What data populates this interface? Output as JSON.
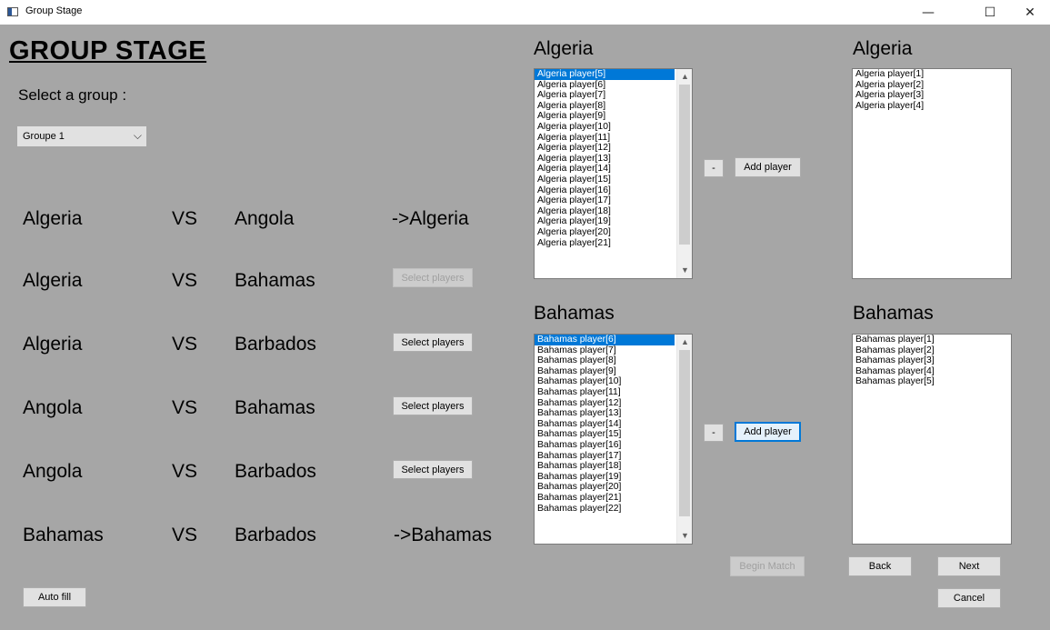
{
  "window": {
    "title": "Group Stage",
    "minimize_glyph": "—",
    "maximize_glyph": "☐",
    "close_glyph": "✕"
  },
  "page": {
    "heading": "GROUP STAGE",
    "select_label": "Select a group :",
    "group_combo": {
      "value": "Groupe 1",
      "chevron": "⌵"
    }
  },
  "matches": [
    {
      "team1": "Algeria",
      "vs": "VS",
      "team2": "Angola",
      "result": "->Algeria",
      "action": ""
    },
    {
      "team1": "Algeria",
      "vs": "VS",
      "team2": "Bahamas",
      "result": "",
      "action": "Select players",
      "disabled": true
    },
    {
      "team1": "Algeria",
      "vs": "VS",
      "team2": "Barbados",
      "result": "",
      "action": "Select players"
    },
    {
      "team1": "Angola",
      "vs": "VS",
      "team2": "Bahamas",
      "result": "",
      "action": "Select players"
    },
    {
      "team1": "Angola",
      "vs": "VS",
      "team2": "Barbados",
      "result": "",
      "action": "Select players"
    },
    {
      "team1": "Bahamas",
      "vs": "VS",
      "team2": "Barbados",
      "result": "->Bahamas",
      "action": ""
    }
  ],
  "team1_panel": {
    "available_title": "Algeria",
    "selected_title": "Algeria",
    "available": [
      "Algeria player[5]",
      "Algeria player[6]",
      "Algeria player[7]",
      "Algeria player[8]",
      "Algeria player[9]",
      "Algeria player[10]",
      "Algeria player[11]",
      "Algeria player[12]",
      "Algeria player[13]",
      "Algeria player[14]",
      "Algeria player[15]",
      "Algeria player[16]",
      "Algeria player[17]",
      "Algeria player[18]",
      "Algeria player[19]",
      "Algeria player[20]",
      "Algeria player[21]"
    ],
    "selected": [
      "Algeria player[1]",
      "Algeria player[2]",
      "Algeria player[3]",
      "Algeria player[4]"
    ],
    "remove_label": "-",
    "add_label": "Add player"
  },
  "team2_panel": {
    "available_title": "Bahamas",
    "selected_title": "Bahamas",
    "available": [
      "Bahamas player[6]",
      "Bahamas player[7]",
      "Bahamas player[8]",
      "Bahamas player[9]",
      "Bahamas player[10]",
      "Bahamas player[11]",
      "Bahamas player[12]",
      "Bahamas player[13]",
      "Bahamas player[14]",
      "Bahamas player[15]",
      "Bahamas player[16]",
      "Bahamas player[17]",
      "Bahamas player[18]",
      "Bahamas player[19]",
      "Bahamas player[20]",
      "Bahamas player[21]",
      "Bahamas player[22]"
    ],
    "selected": [
      "Bahamas player[1]",
      "Bahamas player[2]",
      "Bahamas player[3]",
      "Bahamas player[4]",
      "Bahamas player[5]"
    ],
    "remove_label": "-",
    "add_label": "Add player"
  },
  "footer": {
    "begin_match": "Begin Match",
    "back": "Back",
    "next": "Next",
    "cancel": "Cancel",
    "auto_fill": "Auto fill"
  },
  "scroll_up_glyph": "▲",
  "scroll_down_glyph": "▼"
}
